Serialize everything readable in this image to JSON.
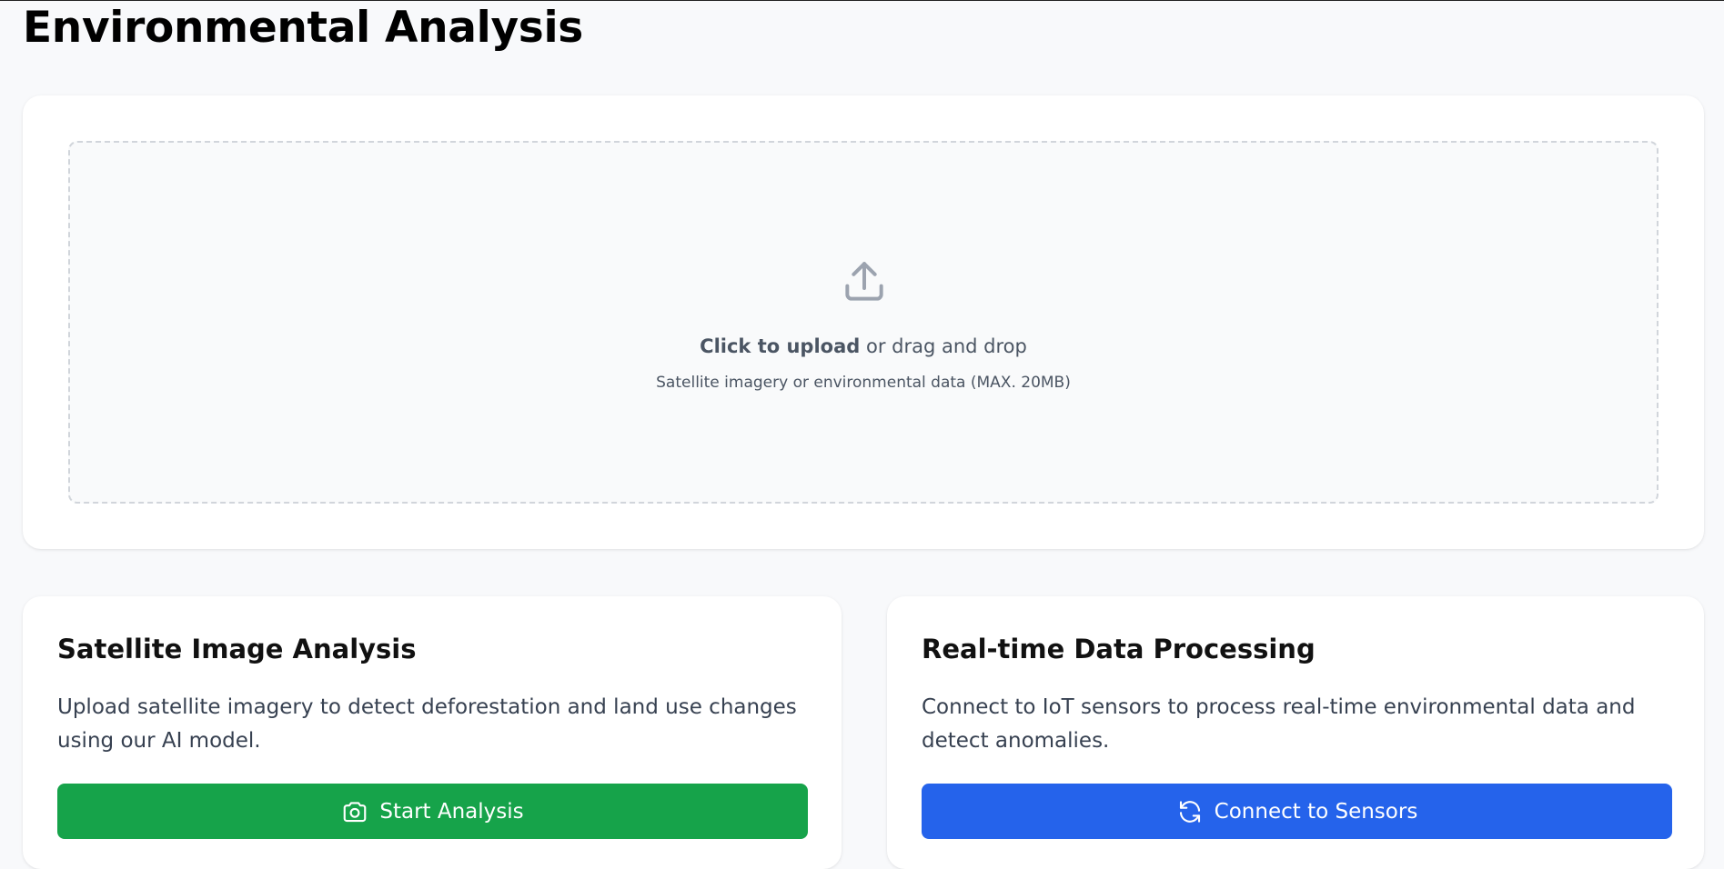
{
  "page": {
    "title": "Environmental Analysis"
  },
  "upload": {
    "icon": "upload-icon",
    "cta_strong": "Click to upload",
    "cta_rest": "or drag and drop",
    "hint": "Satellite imagery or environmental data (MAX. 20MB)"
  },
  "cards": [
    {
      "title": "Satellite Image Analysis",
      "description": "Upload satellite imagery to detect deforestation and land use changes using our AI model.",
      "button_label": "Start Analysis",
      "button_icon": "camera-icon",
      "button_color": "#16a34a"
    },
    {
      "title": "Real-time Data Processing",
      "description": "Connect to IoT sensors to process real-time environmental data and detect anomalies.",
      "button_label": "Connect to Sensors",
      "button_icon": "refresh-icon",
      "button_color": "#2563eb"
    }
  ],
  "colors": {
    "page_background": "#f8f9fb",
    "card_background": "#ffffff",
    "dropzone_border": "#d1d5db",
    "muted_text": "#4b5563"
  }
}
